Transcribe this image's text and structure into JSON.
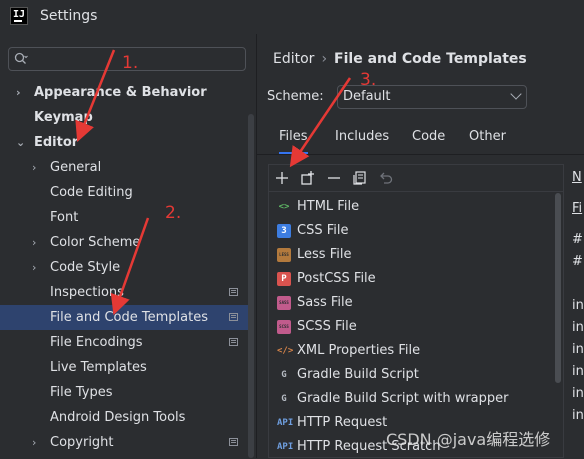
{
  "window": {
    "title": "Settings",
    "logo_text": "IJ"
  },
  "search": {
    "placeholder": ""
  },
  "tree": [
    {
      "label": "Appearance & Behavior",
      "bold": true,
      "chevron": "›",
      "level": 0
    },
    {
      "label": "Keymap",
      "bold": true,
      "chevron": "",
      "level": 0
    },
    {
      "label": "Editor",
      "bold": true,
      "chevron": "⌄",
      "level": 0
    },
    {
      "label": "General",
      "bold": false,
      "chevron": "›",
      "level": 1
    },
    {
      "label": "Code Editing",
      "bold": false,
      "chevron": "",
      "level": 1
    },
    {
      "label": "Font",
      "bold": false,
      "chevron": "",
      "level": 1
    },
    {
      "label": "Color Scheme",
      "bold": false,
      "chevron": "›",
      "level": 1
    },
    {
      "label": "Code Style",
      "bold": false,
      "chevron": "›",
      "level": 1
    },
    {
      "label": "Inspections",
      "bold": false,
      "chevron": "",
      "level": 1,
      "page_icon": true
    },
    {
      "label": "File and Code Templates",
      "bold": false,
      "chevron": "",
      "level": 1,
      "page_icon": true,
      "selected": true
    },
    {
      "label": "File Encodings",
      "bold": false,
      "chevron": "",
      "level": 1,
      "page_icon": true
    },
    {
      "label": "Live Templates",
      "bold": false,
      "chevron": "",
      "level": 1
    },
    {
      "label": "File Types",
      "bold": false,
      "chevron": "",
      "level": 1
    },
    {
      "label": "Android Design Tools",
      "bold": false,
      "chevron": "",
      "level": 1
    },
    {
      "label": "Copyright",
      "bold": false,
      "chevron": "›",
      "level": 1,
      "page_icon": true
    }
  ],
  "breadcrumb": {
    "parent": "Editor",
    "separator": "›",
    "current": "File and Code Templates"
  },
  "scheme": {
    "label": "Scheme:",
    "value": "Default"
  },
  "tabs": [
    {
      "label": "Files",
      "active": true
    },
    {
      "label": "Includes",
      "active": false
    },
    {
      "label": "Code",
      "active": false
    },
    {
      "label": "Other",
      "active": false
    }
  ],
  "toolbar": [
    "add-icon",
    "add-child-icon",
    "remove-icon",
    "copy-icon",
    "reset-icon"
  ],
  "files": [
    {
      "name": "HTML File",
      "icon": "html-icon",
      "icon_text": "<>",
      "color": "#5fb865"
    },
    {
      "name": "CSS File",
      "icon": "css-icon",
      "icon_text": "3",
      "color": "#3d7de0"
    },
    {
      "name": "Less File",
      "icon": "less-icon",
      "icon_text": "LESS",
      "color": "#b37a3d"
    },
    {
      "name": "PostCSS File",
      "icon": "postcss-icon",
      "icon_text": "P",
      "color": "#d9534f"
    },
    {
      "name": "Sass File",
      "icon": "sass-icon",
      "icon_text": "SASS",
      "color": "#c15b8c"
    },
    {
      "name": "SCSS File",
      "icon": "scss-icon",
      "icon_text": "SCSS",
      "color": "#c15b8c"
    },
    {
      "name": "XML Properties File",
      "icon": "xml-icon",
      "icon_text": "</>",
      "color": "#d9854a"
    },
    {
      "name": "Gradle Build Script",
      "icon": "gradle-icon",
      "icon_text": "G",
      "color": "#b7bcc4"
    },
    {
      "name": "Gradle Build Script with wrapper",
      "icon": "gradle-icon",
      "icon_text": "G",
      "color": "#b7bcc4"
    },
    {
      "name": "HTTP Request",
      "icon": "api-icon",
      "icon_text": "API",
      "color": "#6f9fe0"
    },
    {
      "name": "HTTP Request Scratch",
      "icon": "api-icon",
      "icon_text": "API",
      "color": "#6f9fe0"
    }
  ],
  "side_fragments": [
    "N",
    "Fi",
    "#",
    "#",
    "in",
    "in",
    "in",
    "in",
    "in",
    "in"
  ],
  "annotations": [
    "1.",
    "2.",
    "3."
  ],
  "watermark": "CSDN @java编程选修",
  "colors": {
    "accent": "#3574f0",
    "selection": "#2e436e",
    "annotation": "#e53935"
  }
}
